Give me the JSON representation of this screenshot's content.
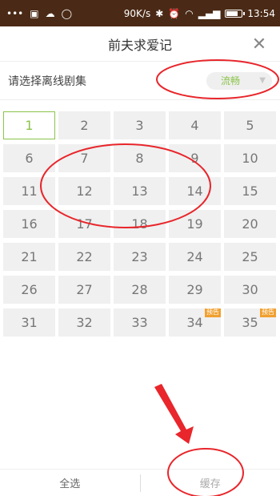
{
  "status_bar": {
    "left_icons": [
      "more-dots-icon",
      "image-icon",
      "cloud-icon",
      "chat-icon"
    ],
    "speed": "90K/s",
    "time": "13:54",
    "right_icons": [
      "bluetooth-icon",
      "alarm-icon",
      "wifi-icon",
      "signal-icon",
      "battery-icon"
    ]
  },
  "header": {
    "title": "前夫求爱记",
    "close": "✕"
  },
  "select_row": {
    "label": "请选择离线剧集",
    "quality": "流畅"
  },
  "episodes": [
    {
      "num": "1",
      "selected": true
    },
    {
      "num": "2"
    },
    {
      "num": "3"
    },
    {
      "num": "4"
    },
    {
      "num": "5"
    },
    {
      "num": "6"
    },
    {
      "num": "7"
    },
    {
      "num": "8"
    },
    {
      "num": "9"
    },
    {
      "num": "10"
    },
    {
      "num": "11"
    },
    {
      "num": "12"
    },
    {
      "num": "13"
    },
    {
      "num": "14"
    },
    {
      "num": "15"
    },
    {
      "num": "16"
    },
    {
      "num": "17"
    },
    {
      "num": "18"
    },
    {
      "num": "19"
    },
    {
      "num": "20"
    },
    {
      "num": "21"
    },
    {
      "num": "22"
    },
    {
      "num": "23"
    },
    {
      "num": "24"
    },
    {
      "num": "25"
    },
    {
      "num": "26"
    },
    {
      "num": "27"
    },
    {
      "num": "28"
    },
    {
      "num": "29"
    },
    {
      "num": "30"
    },
    {
      "num": "31"
    },
    {
      "num": "32"
    },
    {
      "num": "33"
    },
    {
      "num": "34",
      "badge": "预告"
    },
    {
      "num": "35",
      "badge": "预告"
    }
  ],
  "bottom": {
    "select_all": "全选",
    "cache": "缓存"
  },
  "colors": {
    "accent": "#8bc34a",
    "annotation": "#e8262b",
    "status_bar_bg": "#4a2a16"
  }
}
